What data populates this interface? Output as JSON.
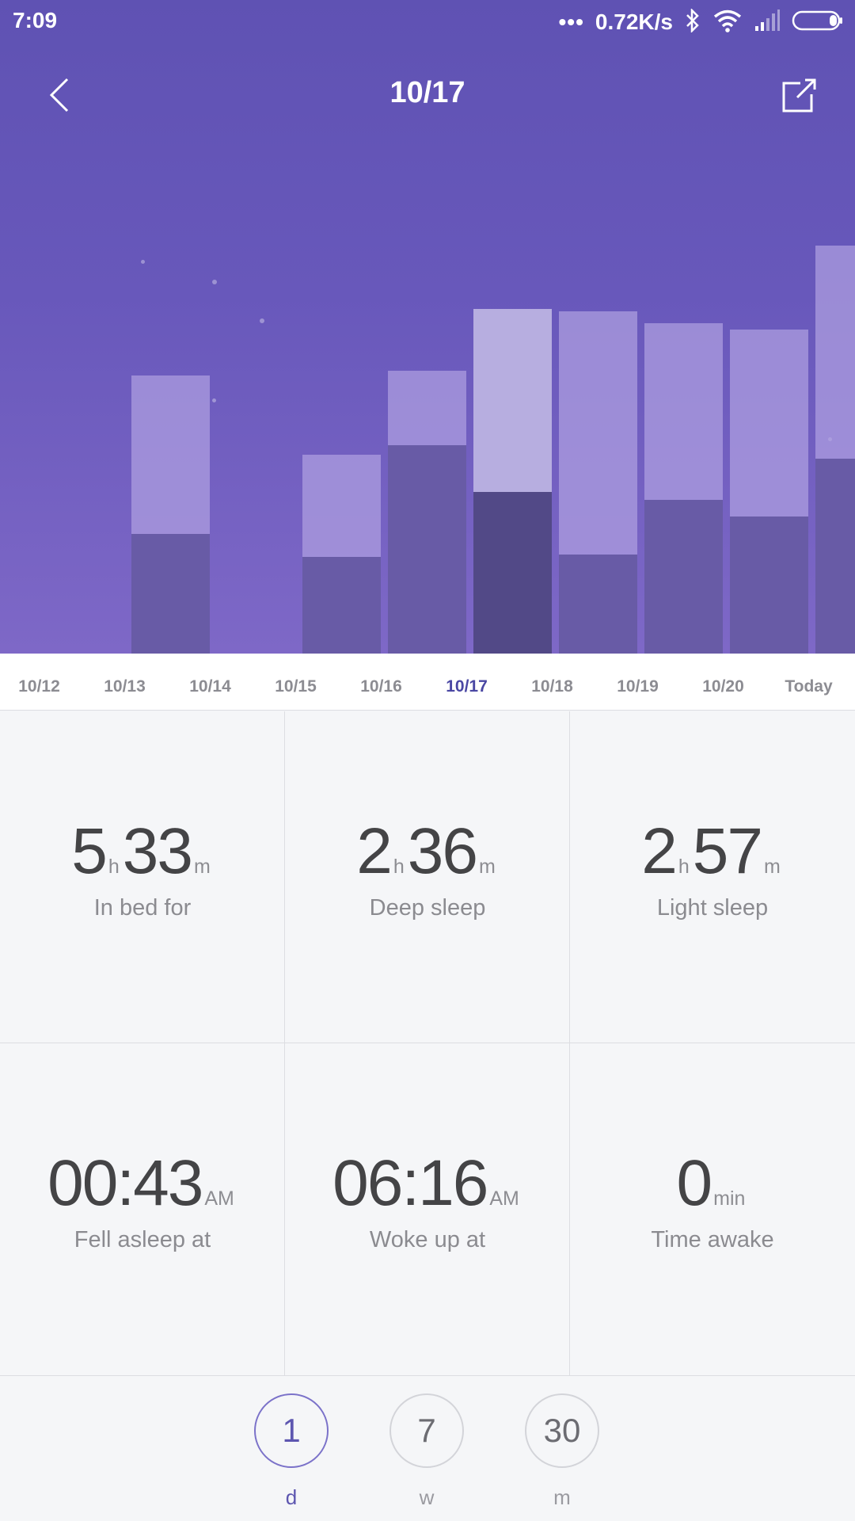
{
  "status_bar": {
    "time": "7:09",
    "network_speed": "0.72K/s",
    "icons": [
      "more-dots-icon",
      "bluetooth-icon",
      "wifi-icon",
      "signal-icon",
      "battery-icon"
    ]
  },
  "header": {
    "title": "10/17",
    "back_icon": "chevron-left-icon",
    "share_icon": "share-icon"
  },
  "colors": {
    "header_bg": "#6356b5",
    "bar_light": "#9b8ed2",
    "bar_deep": "#685ba6",
    "selected_light": "#b7aee0",
    "selected_deep": "#524987",
    "accent": "#4a47a3"
  },
  "chart_data": {
    "type": "bar",
    "stacked": true,
    "categories": [
      "10/12",
      "10/13",
      "10/14",
      "10/15",
      "10/16",
      "10/17",
      "10/18",
      "10/19",
      "10/20",
      "Today"
    ],
    "selected": "10/17",
    "series": [
      {
        "name": "Deep sleep",
        "values": [
          null,
          1.93,
          0,
          1.55,
          3.35,
          2.6,
          1.6,
          2.48,
          2.21,
          3.14
        ]
      },
      {
        "name": "Light sleep",
        "values": [
          null,
          2.55,
          0,
          1.64,
          1.2,
          2.95,
          3.92,
          2.84,
          3.01,
          3.43
        ]
      }
    ],
    "ylabel": "",
    "xlabel": ""
  },
  "stats": [
    {
      "parts": [
        {
          "num": "5",
          "unit": "h"
        },
        {
          "num": "33",
          "unit": "m"
        }
      ],
      "label": "In bed for"
    },
    {
      "parts": [
        {
          "num": "2",
          "unit": "h"
        },
        {
          "num": "36",
          "unit": "m"
        }
      ],
      "label": "Deep sleep"
    },
    {
      "parts": [
        {
          "num": "2",
          "unit": "h"
        },
        {
          "num": "57",
          "unit": "m"
        }
      ],
      "label": "Light sleep"
    },
    {
      "parts": [
        {
          "num": "00:43",
          "unit": "AM"
        }
      ],
      "label": "Fell asleep at"
    },
    {
      "parts": [
        {
          "num": "06:16",
          "unit": "AM"
        }
      ],
      "label": "Woke up at"
    },
    {
      "parts": [
        {
          "num": "0",
          "unit": "min"
        }
      ],
      "label": "Time awake"
    }
  ],
  "period_selector": [
    {
      "value": "1",
      "label": "d",
      "active": true
    },
    {
      "value": "7",
      "label": "w",
      "active": false
    },
    {
      "value": "30",
      "label": "m",
      "active": false
    }
  ]
}
